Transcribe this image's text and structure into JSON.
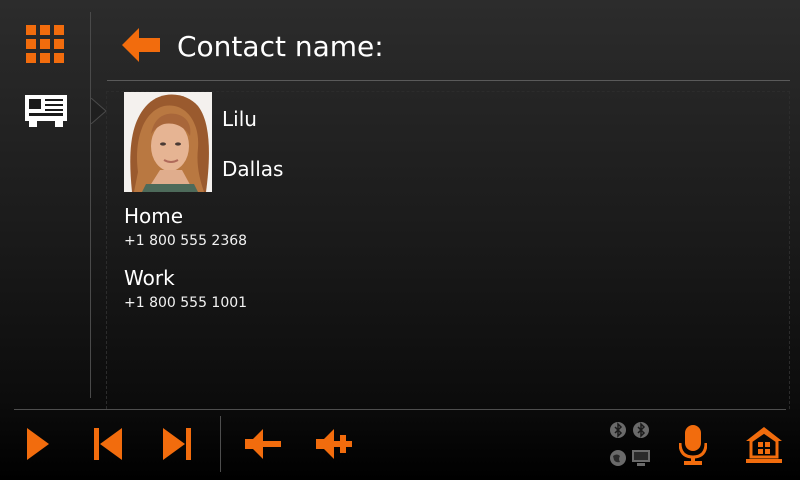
{
  "header": {
    "title": "Contact name:"
  },
  "contact": {
    "name": "Lilu",
    "city": "Dallas",
    "phones": [
      {
        "label": "Home",
        "number": "+1 800 555 2368"
      },
      {
        "label": "Work",
        "number": "+1 800 555 1001"
      }
    ]
  },
  "icons": {
    "apps": "grid-icon",
    "contact_card": "contact-card-icon",
    "back": "back-arrow-icon",
    "play": "play-icon",
    "previous": "previous-track-icon",
    "next": "next-track-icon",
    "volume_down": "volume-down-icon",
    "volume_up": "volume-up-icon",
    "bluetooth": "bluetooth-icon",
    "globe": "globe-icon",
    "monitor": "monitor-icon",
    "microphone": "microphone-icon",
    "home": "home-icon"
  },
  "colors": {
    "accent": "#f26c0d",
    "text": "#ffffff",
    "background": "#1a1a1a"
  }
}
